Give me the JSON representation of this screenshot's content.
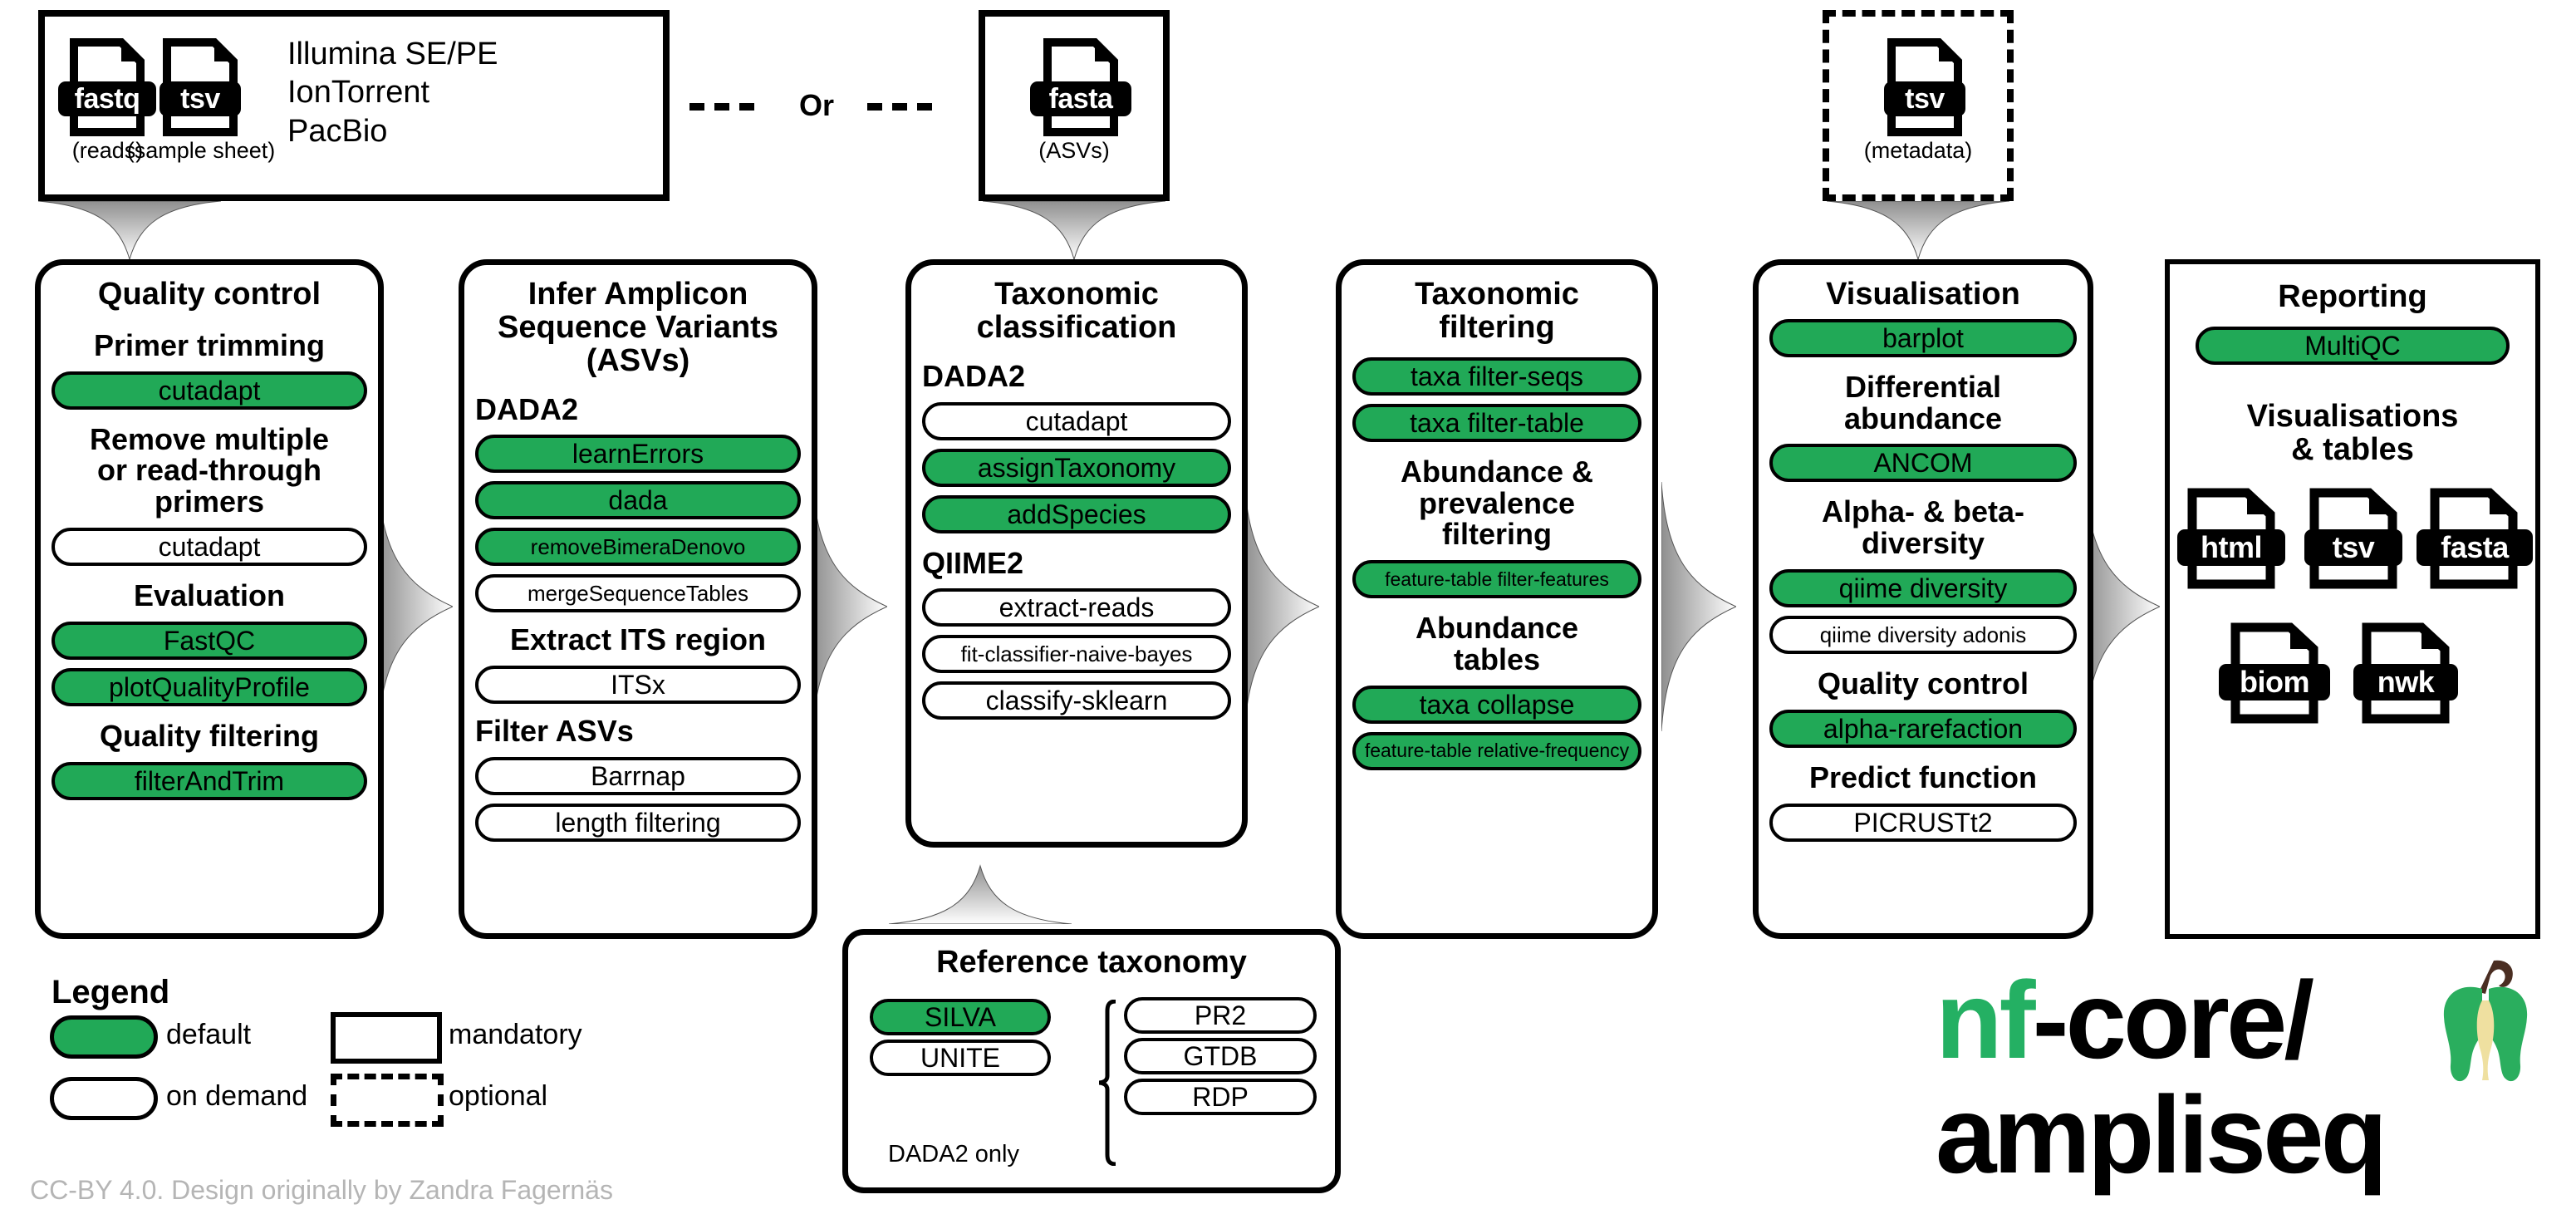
{
  "colors": {
    "default_green": "#21A957",
    "logo_green": "#24B063",
    "apple_core": "#EFE0A0",
    "apple_stem": "#4A2E22",
    "footer_gray": "#B5B5B5"
  },
  "inputs": {
    "reads_box": {
      "files": [
        {
          "ext": "fastq",
          "caption": "(reads)"
        },
        {
          "ext": "tsv",
          "caption": "(sample sheet)"
        }
      ],
      "or_label": "Or",
      "platforms": [
        "Illumina SE/PE",
        "IonTorrent",
        "PacBio"
      ]
    },
    "or_separator": "Or",
    "asv_box": {
      "files": [
        {
          "ext": "fasta",
          "caption": "(ASVs)"
        }
      ]
    },
    "metadata_box": {
      "files": [
        {
          "ext": "tsv",
          "caption": "(metadata)"
        }
      ],
      "optional": true
    }
  },
  "columns": [
    {
      "title": "Quality control",
      "sections": [
        {
          "heading": "Primer trimming",
          "tools": [
            {
              "name": "cutadapt",
              "style": "default"
            }
          ]
        },
        {
          "heading": "Remove multiple\nor read-through\nprimers",
          "tools": [
            {
              "name": "cutadapt",
              "style": "on-demand"
            }
          ]
        },
        {
          "heading": "Evaluation",
          "tools": [
            {
              "name": "FastQC",
              "style": "default"
            },
            {
              "name": "plotQualityProfile",
              "style": "default"
            }
          ]
        },
        {
          "heading": "Quality filtering",
          "tools": [
            {
              "name": "filterAndTrim",
              "style": "default"
            }
          ]
        }
      ]
    },
    {
      "title": "Infer Amplicon\nSequence Variants\n(ASVs)",
      "sections": [
        {
          "heading": "DADA2",
          "tools": [
            {
              "name": "learnErrors",
              "style": "default"
            },
            {
              "name": "dada",
              "style": "default"
            },
            {
              "name": "removeBimeraDenovo",
              "style": "default"
            },
            {
              "name": "mergeSequenceTables",
              "style": "on-demand"
            }
          ]
        },
        {
          "heading": "Extract ITS region",
          "tools": [
            {
              "name": "ITSx",
              "style": "on-demand"
            }
          ]
        },
        {
          "heading": "Filter ASVs",
          "tools": [
            {
              "name": "Barrnap",
              "style": "on-demand"
            },
            {
              "name": "length filtering",
              "style": "on-demand"
            }
          ]
        }
      ]
    },
    {
      "title": "Taxonomic\nclassification",
      "sections": [
        {
          "heading": "DADA2",
          "tools": [
            {
              "name": "cutadapt",
              "style": "on-demand"
            },
            {
              "name": "assignTaxonomy",
              "style": "default"
            },
            {
              "name": "addSpecies",
              "style": "default"
            }
          ]
        },
        {
          "heading": "QIIME2",
          "tools": [
            {
              "name": "extract-reads",
              "style": "on-demand"
            },
            {
              "name": "fit-classifier-naive-bayes",
              "style": "on-demand"
            },
            {
              "name": "classify-sklearn",
              "style": "on-demand"
            }
          ]
        }
      ]
    },
    {
      "title": "Taxonomic\nfiltering",
      "sections": [
        {
          "heading": "",
          "tools": [
            {
              "name": "taxa filter-seqs",
              "style": "default"
            },
            {
              "name": "taxa filter-table",
              "style": "default"
            }
          ]
        },
        {
          "heading": "Abundance &\nprevalence\nfiltering",
          "tools": [
            {
              "name": "feature-table filter-features",
              "style": "default"
            }
          ]
        },
        {
          "heading": "Abundance\ntables",
          "tools": [
            {
              "name": "taxa collapse",
              "style": "default"
            },
            {
              "name": "feature-table relative-frequency",
              "style": "default"
            }
          ]
        }
      ]
    },
    {
      "title": "Visualisation",
      "sections": [
        {
          "heading": "",
          "tools": [
            {
              "name": "barplot",
              "style": "default"
            }
          ]
        },
        {
          "heading": "Differential\nabundance",
          "tools": [
            {
              "name": "ANCOM",
              "style": "default"
            }
          ]
        },
        {
          "heading": "Alpha- & beta-\ndiversity",
          "tools": [
            {
              "name": "qiime diversity",
              "style": "default"
            },
            {
              "name": "qiime diversity adonis",
              "style": "on-demand"
            }
          ]
        },
        {
          "heading": "Quality control",
          "tools": [
            {
              "name": "alpha-rarefaction",
              "style": "default"
            }
          ]
        },
        {
          "heading": "Predict function",
          "tools": [
            {
              "name": "PICRUSTt2",
              "style": "on-demand"
            }
          ]
        }
      ]
    },
    {
      "title": "Reporting",
      "sections": [
        {
          "heading": "",
          "tools": [
            {
              "name": "MultiQC",
              "style": "default"
            }
          ]
        },
        {
          "heading": "Visualisations\n& tables",
          "tools": []
        }
      ],
      "output_files": [
        "html",
        "tsv",
        "fasta",
        "biom",
        "nwk"
      ]
    }
  ],
  "reference_taxonomy": {
    "title": "Reference taxonomy",
    "left_column": [
      {
        "name": "SILVA",
        "style": "default"
      },
      {
        "name": "UNITE",
        "style": "on-demand"
      }
    ],
    "right_column": [
      {
        "name": "PR2",
        "style": "on-demand"
      },
      {
        "name": "GTDB",
        "style": "on-demand"
      },
      {
        "name": "RDP",
        "style": "on-demand"
      }
    ],
    "bracket_label": "DADA2 only"
  },
  "legend": {
    "title": "Legend",
    "entries": [
      {
        "shape": "pill-green",
        "label": "default"
      },
      {
        "shape": "rect-solid",
        "label": "mandatory"
      },
      {
        "shape": "pill-white",
        "label": "on demand"
      },
      {
        "shape": "rect-dashed",
        "label": "optional"
      }
    ]
  },
  "logo": {
    "line1_green": "nf",
    "line1_black": "-core/",
    "line2": "ampliseq"
  },
  "footer": "CC-BY 4.0. Design originally by Zandra Fagernäs"
}
